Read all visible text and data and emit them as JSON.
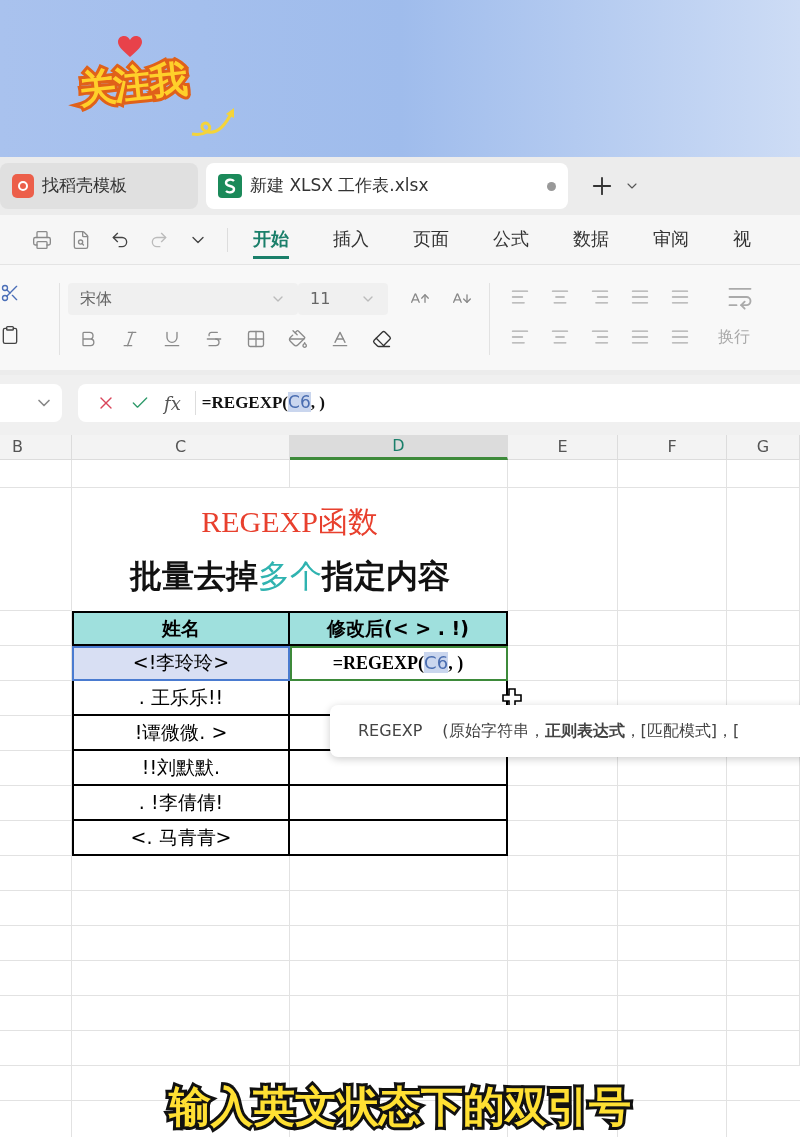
{
  "overlay": {
    "sticker": "关注我",
    "caption": "输入英文状态下的双引号"
  },
  "tabs": [
    {
      "label": "找稻壳模板",
      "kind": "docer",
      "selected": false,
      "modified": false
    },
    {
      "label": "新建 XLSX 工作表.xlsx",
      "kind": "sheet",
      "selected": true,
      "modified": true
    }
  ],
  "menu": [
    {
      "label": "开始",
      "selected": true
    },
    {
      "label": "插入",
      "selected": false
    },
    {
      "label": "页面",
      "selected": false
    },
    {
      "label": "公式",
      "selected": false
    },
    {
      "label": "数据",
      "selected": false
    },
    {
      "label": "审阅",
      "selected": false
    },
    {
      "label": "视",
      "selected": false
    }
  ],
  "ribbon": {
    "font_name": "宋体",
    "font_size": "11",
    "wrap_label": "换行"
  },
  "formula_bar": {
    "fx_label": "fx",
    "prefix": "=REGEXP(",
    "reference": "C6",
    "suffix": ", )"
  },
  "columns": [
    {
      "label": "B",
      "selected": false
    },
    {
      "label": "C",
      "selected": false
    },
    {
      "label": "D",
      "selected": true
    },
    {
      "label": "E",
      "selected": false
    },
    {
      "label": "F",
      "selected": false
    },
    {
      "label": "G",
      "selected": false
    }
  ],
  "sheet": {
    "title": "REGEXP函数",
    "subtitle": [
      {
        "text": "批量去掉",
        "highlight": false
      },
      {
        "text": "多个",
        "highlight": true
      },
      {
        "text": "指定内容",
        "highlight": false
      }
    ],
    "headers": [
      "姓名",
      "修改后(< > . !)"
    ],
    "rows": [
      {
        "name": "<!李玲玲>",
        "selected": true,
        "editing": true
      },
      {
        "name": ". 王乐乐!!",
        "selected": false,
        "editing": false
      },
      {
        "name": "!谭微微. >",
        "selected": false,
        "editing": false
      },
      {
        "name": "!!刘默默.",
        "selected": false,
        "editing": false
      },
      {
        "name": ". !李倩倩!",
        "selected": false,
        "editing": false
      },
      {
        "name": "<. 马青青>",
        "selected": false,
        "editing": false
      }
    ],
    "cell_editor": {
      "prefix": "=REGEXP(",
      "reference": "C6",
      "suffix": ", )"
    }
  },
  "tooltip": {
    "function": "REGEXP",
    "args": "(原始字符串，**正则表达式**，[匹配模式]，["
  }
}
